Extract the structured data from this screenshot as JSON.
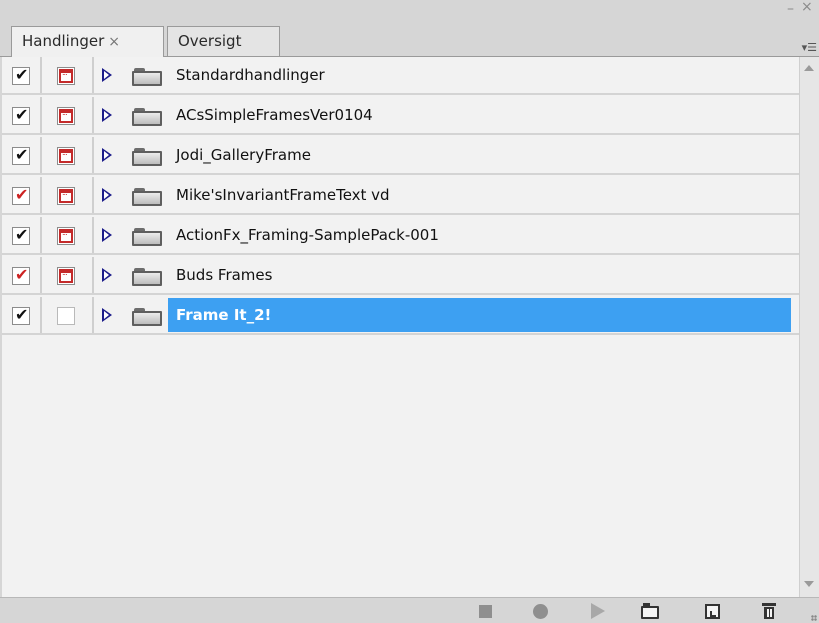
{
  "panel": {
    "tabs": [
      {
        "label": "Handlinger",
        "close": "×",
        "active": true
      },
      {
        "label": "Oversigt",
        "active": false
      }
    ],
    "controls": {
      "minimize": "–",
      "close": "×",
      "menu": "▾☰"
    }
  },
  "actions": {
    "rows": [
      {
        "label": "Standardhandlinger",
        "check_mark": "✔",
        "check_color": "#111111",
        "dialog": true,
        "selected": false
      },
      {
        "label": "ACsSimpleFramesVer0104",
        "check_mark": "✔",
        "check_color": "#111111",
        "dialog": true,
        "selected": false
      },
      {
        "label": "Jodi_GalleryFrame",
        "check_mark": "✔",
        "check_color": "#111111",
        "dialog": true,
        "selected": false
      },
      {
        "label": "Mike'sInvariantFrameText vd",
        "check_mark": "✔",
        "check_color": "#cc2222",
        "dialog": true,
        "selected": false
      },
      {
        "label": "ActionFx_Framing-SamplePack-001",
        "check_mark": "✔",
        "check_color": "#111111",
        "dialog": true,
        "selected": false
      },
      {
        "label": "Buds Frames",
        "check_mark": "✔",
        "check_color": "#cc2222",
        "dialog": true,
        "selected": false
      },
      {
        "label": "Frame It_2!",
        "check_mark": "✔",
        "check_color": "#111111",
        "dialog": false,
        "selected": true
      }
    ]
  },
  "toolbar": {
    "icons": [
      "stop-icon",
      "record-icon",
      "play-icon",
      "new-set-icon",
      "new-action-icon",
      "delete-icon"
    ]
  },
  "colors": {
    "selection": "#3da0f2",
    "dialog_icon": "#c42a2a",
    "expand_triangle": "#1c1c8a"
  }
}
